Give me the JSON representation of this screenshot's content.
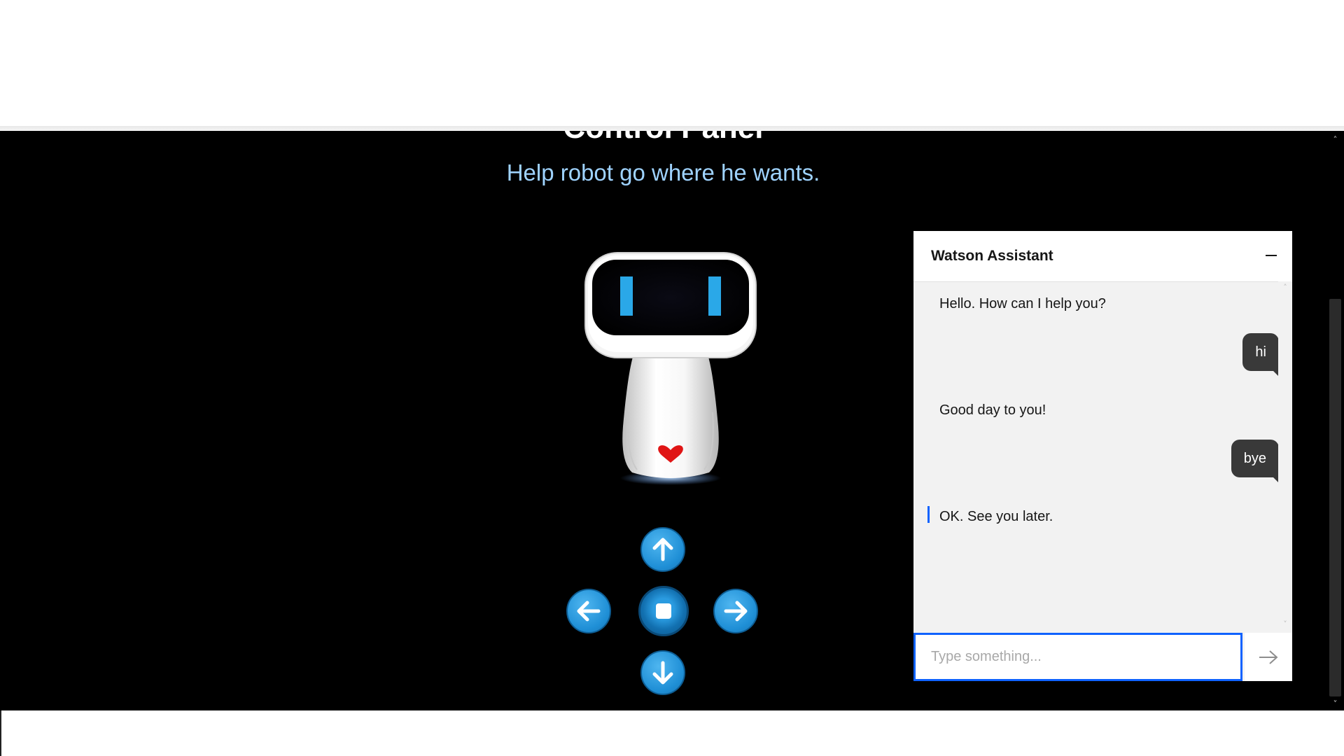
{
  "panel": {
    "title": "Control Panel",
    "subtitle": "Help robot go where he wants."
  },
  "controls": {
    "up_icon": "arrow-up-icon",
    "left_icon": "arrow-left-icon",
    "right_icon": "arrow-right-icon",
    "down_icon": "arrow-down-icon",
    "stop_icon": "stop-icon",
    "accent": "#1f8fd6"
  },
  "chat": {
    "title": "Watson Assistant",
    "messages": [
      {
        "from": "bot",
        "text": "Hello. How can I help you?"
      },
      {
        "from": "user",
        "text": "hi"
      },
      {
        "from": "bot",
        "text": "Good day to you!"
      },
      {
        "from": "user",
        "text": "bye"
      },
      {
        "from": "bot",
        "text": "OK. See you later."
      }
    ],
    "input_placeholder": "Type something...",
    "input_value": "",
    "accent": "#0f62fe",
    "user_bubble_color": "#393939"
  }
}
